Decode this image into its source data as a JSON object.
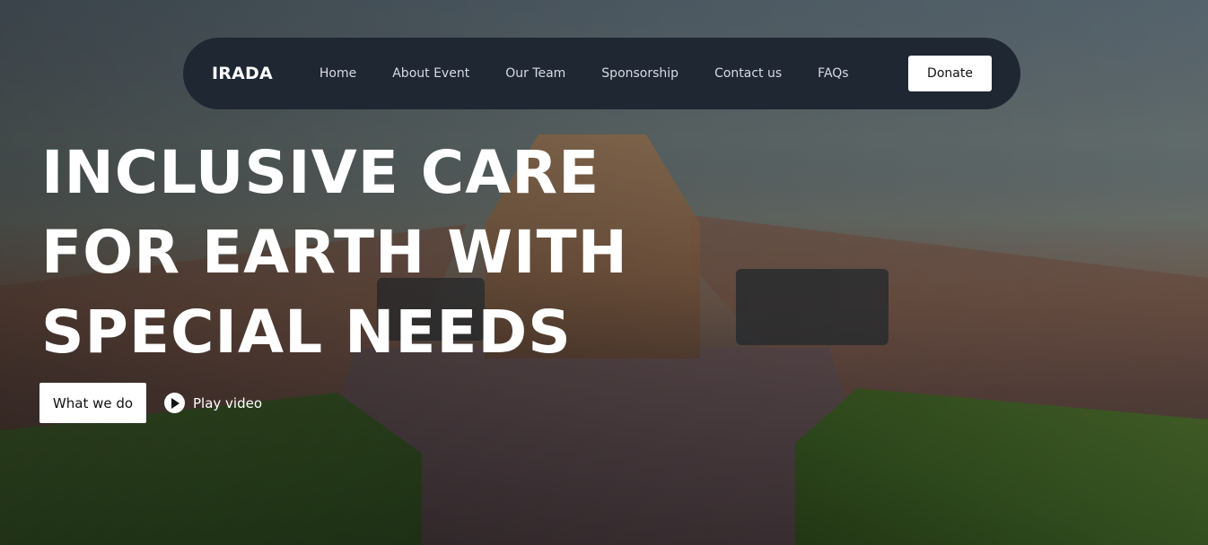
{
  "brand": "IRADA",
  "nav": {
    "links": [
      "Home",
      "About Event",
      "Our Team",
      "Sponsorship",
      "Contact us",
      "FAQs"
    ],
    "donate_label": "Donate"
  },
  "hero": {
    "title_lines": [
      "INCLUSIVE CARE",
      "FOR EARTH WITH",
      "SPECIAL NEEDS"
    ],
    "primary_cta": "What we do",
    "video_cta": "Play video",
    "video_icon": "play-circle-icon"
  },
  "colors": {
    "nav_bg": "#1f2733",
    "button_bg": "#ffffff",
    "text_light": "#ffffff"
  }
}
